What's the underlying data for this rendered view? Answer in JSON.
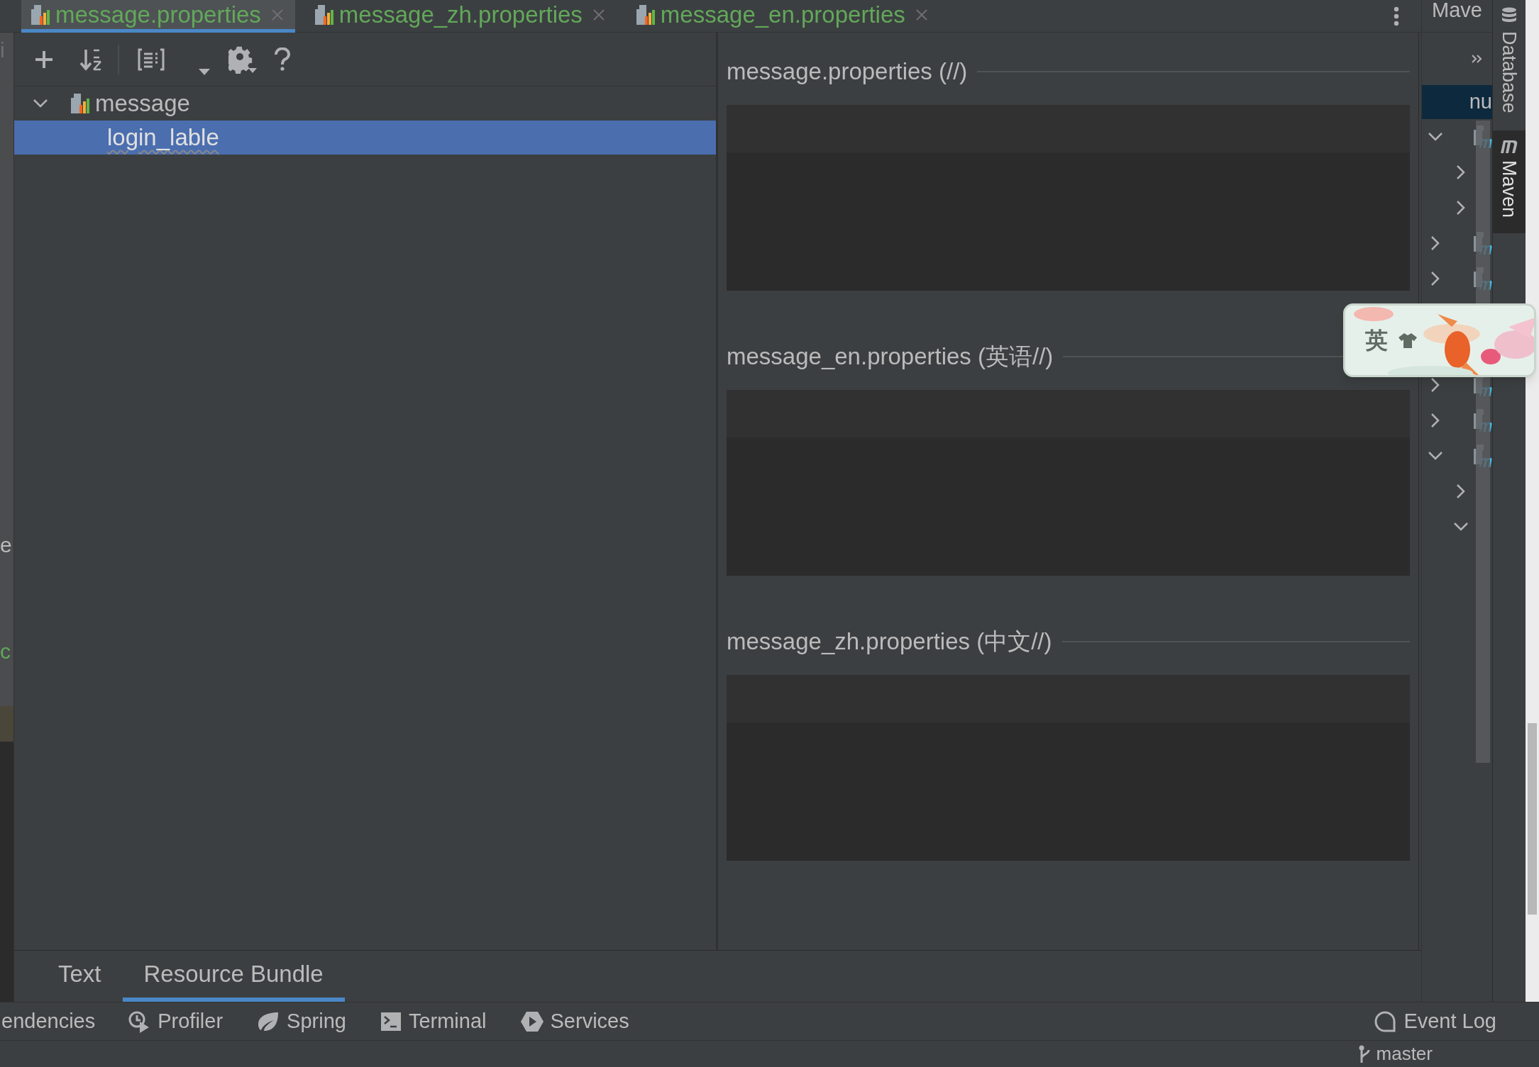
{
  "tabs": [
    {
      "label": "message.properties",
      "selected": true
    },
    {
      "label": "message_zh.properties",
      "selected": false
    },
    {
      "label": "message_en.properties",
      "selected": false
    }
  ],
  "maven_header": "Mave",
  "left_edge": [
    {
      "text": "i",
      "kind": "muted"
    },
    {
      "text": "e",
      "kind": "plain"
    },
    {
      "text": "c",
      "kind": "string"
    }
  ],
  "tree": [
    {
      "label": "message",
      "expanded": true,
      "selected": false,
      "children": [
        {
          "label": "login_lable",
          "selected": true
        }
      ]
    }
  ],
  "sections": [
    {
      "title": "message.properties (//)"
    },
    {
      "title": "message_en.properties (英语//)"
    },
    {
      "title": "message_zh.properties (中文//)"
    }
  ],
  "editor_tabs": [
    {
      "label": "Text",
      "selected": false
    },
    {
      "label": "Resource Bundle",
      "selected": true
    }
  ],
  "maven": {
    "selected_row": "nu",
    "rows": [
      {
        "expanded": true,
        "children": [
          {
            "expanded": false
          },
          {
            "expanded": false
          }
        ]
      },
      {
        "expanded": false
      },
      {
        "expanded": false
      },
      {
        "expanded": false
      },
      {
        "expanded": false
      },
      {
        "expanded": true,
        "children": [
          {
            "expanded": false
          },
          {
            "expanded": true
          }
        ]
      }
    ]
  },
  "side_tabs": [
    {
      "label": "Database",
      "kind": "database",
      "selected": false
    },
    {
      "label": "Maven",
      "kind": "maven",
      "selected": true
    }
  ],
  "tool_windows": [
    {
      "label": "endencies",
      "kind": "plain"
    },
    {
      "label": "Profiler",
      "kind": "profiler"
    },
    {
      "label": "Spring",
      "kind": "spring"
    },
    {
      "label": "Terminal",
      "kind": "terminal"
    },
    {
      "label": "Services",
      "kind": "services"
    }
  ],
  "event_log": "Event Log",
  "status": {
    "branch": "master"
  },
  "ime": {
    "label": "英"
  }
}
